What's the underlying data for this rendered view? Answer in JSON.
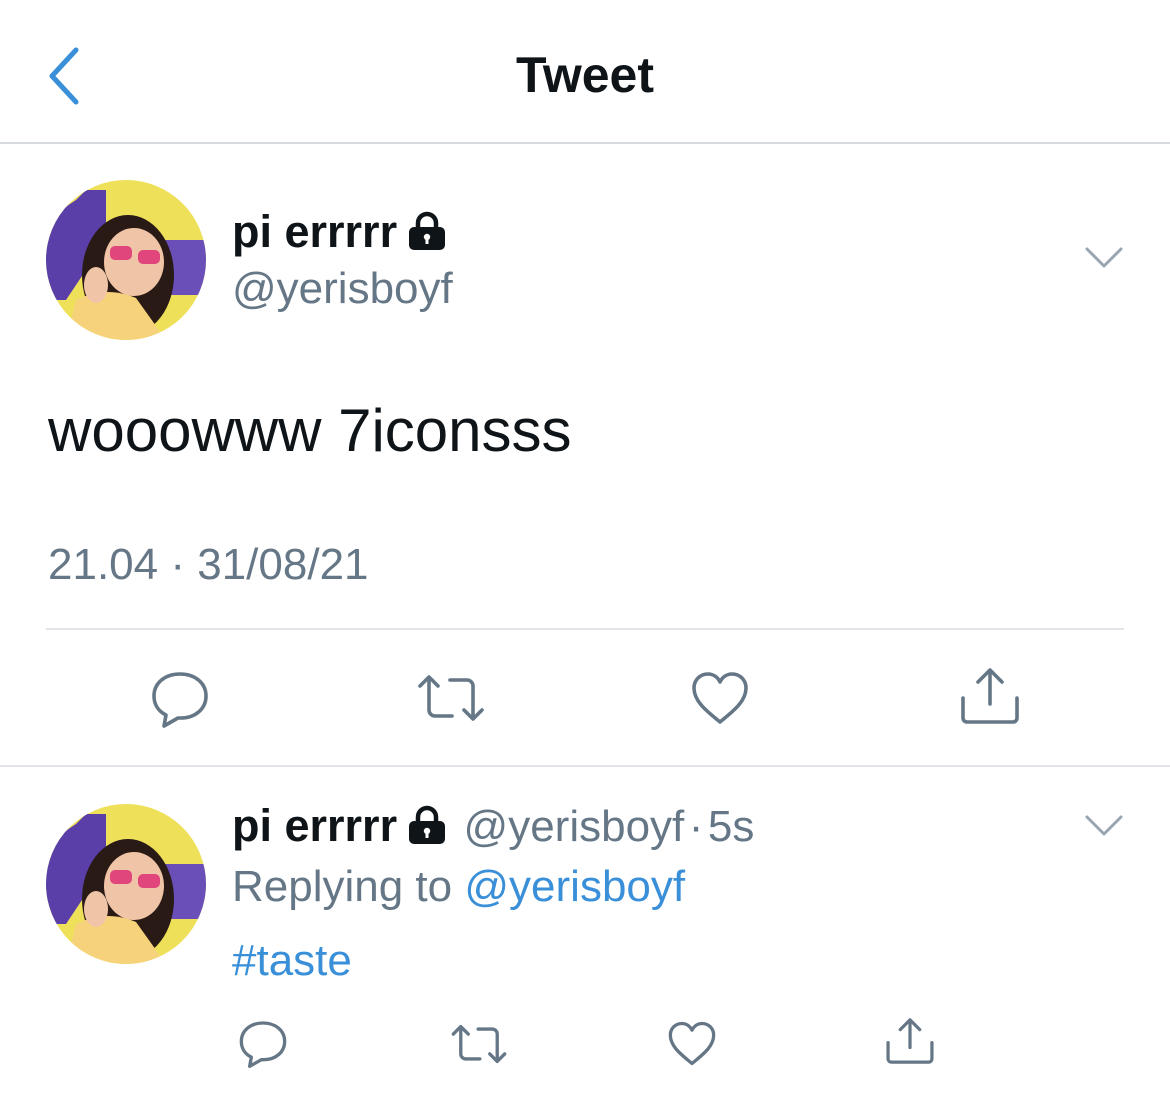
{
  "header": {
    "title": "Tweet",
    "back_icon": "chevron-left-icon"
  },
  "main_tweet": {
    "display_name": "pi errrrr",
    "handle": "@yerisboyf",
    "text": "wooowww 7iconsss",
    "time": "21.04",
    "separator": "·",
    "date": "31/08/21",
    "actions": [
      "reply-icon",
      "retweet-icon",
      "like-icon",
      "share-icon"
    ]
  },
  "reply_tweet": {
    "display_name": "pi errrrr",
    "handle": "@yerisboyf",
    "dot": "·",
    "age": "5s",
    "replying_prefix": "Replying to",
    "replying_to": "@yerisboyf",
    "text": "#taste",
    "actions": [
      "reply-icon",
      "retweet-icon",
      "like-icon",
      "share-icon"
    ]
  },
  "colors": {
    "accent": "#3a8fd9",
    "muted": "#657786",
    "text": "#0f1419",
    "divider": "#e1e4e8"
  }
}
